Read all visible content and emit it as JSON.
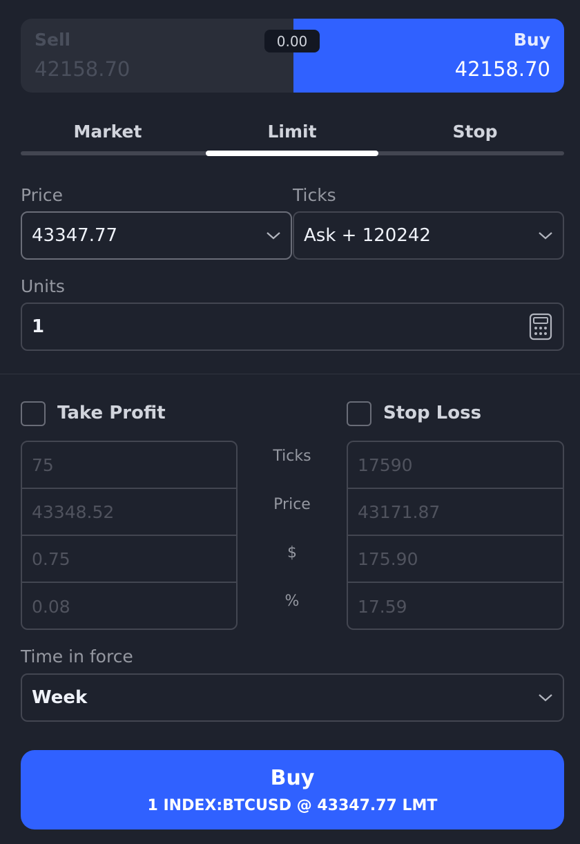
{
  "order_side": {
    "sell_label": "Sell",
    "sell_price": "42158.70",
    "buy_label": "Buy",
    "buy_price": "42158.70",
    "spread": "0.00",
    "selected": "Buy"
  },
  "tabs": [
    {
      "label": "Market",
      "active": false
    },
    {
      "label": "Limit",
      "active": true
    },
    {
      "label": "Stop",
      "active": false
    }
  ],
  "price": {
    "label": "Price",
    "value": "43347.77"
  },
  "ticks": {
    "label": "Ticks",
    "value": "Ask + 120242"
  },
  "units": {
    "label": "Units",
    "value": "1",
    "icon": "calculator-icon"
  },
  "take_profit": {
    "label": "Take Profit",
    "checked": false,
    "ticks": "75",
    "price": "43348.52",
    "dollars": "0.75",
    "percent": "0.08"
  },
  "stop_loss": {
    "label": "Stop Loss",
    "checked": false,
    "ticks": "17590",
    "price": "43171.87",
    "dollars": "175.90",
    "percent": "17.59"
  },
  "row_labels": {
    "ticks": "Ticks",
    "price": "Price",
    "dollars": "$",
    "percent": "%"
  },
  "time_in_force": {
    "label": "Time in force",
    "value": "Week"
  },
  "submit": {
    "title": "Buy",
    "subtitle": "1 INDEX:BTCUSD @ 43347.77 LMT"
  },
  "colors": {
    "background": "#1e222d",
    "accent": "#3061ff",
    "panel": "#2a2e39",
    "border": "#434651"
  }
}
